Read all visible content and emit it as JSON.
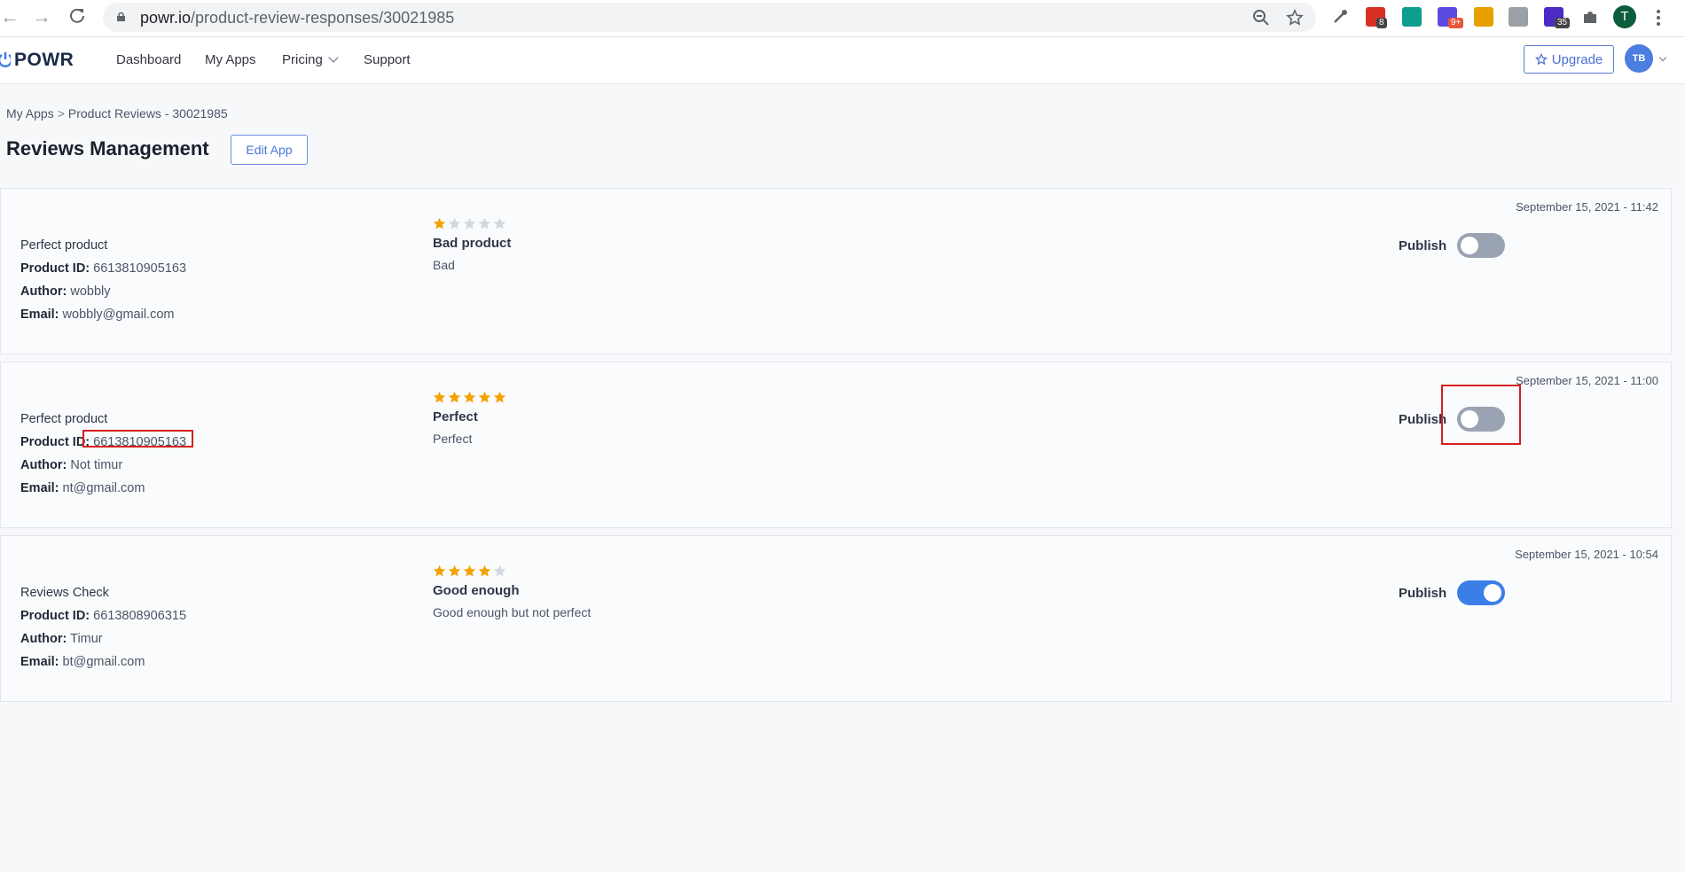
{
  "browser": {
    "url_host": "powr.io",
    "url_path": "/product-review-responses/30021985",
    "extensions": [
      {
        "icon": "mail-extension-icon",
        "badge": "8",
        "color": "#d93025"
      },
      {
        "icon": "chat-extension-icon",
        "badge": "",
        "color": "#0f9d8f"
      },
      {
        "icon": "sun-extension-icon",
        "badge": "9+",
        "color": "#5b4be0"
      },
      {
        "icon": "number-extension-icon",
        "badge": "",
        "color": "#e8a000"
      },
      {
        "icon": "profile-extension-icon",
        "badge": "",
        "color": "#9aa0a6"
      },
      {
        "icon": "graduation-extension-icon",
        "badge": "35",
        "color": "#4b2ac6"
      }
    ],
    "profile_initial": "T"
  },
  "header": {
    "logo": "POWR",
    "nav": [
      "Dashboard",
      "My Apps",
      "Pricing",
      "Support"
    ],
    "upgrade_label": "Upgrade",
    "user_initials": "TB"
  },
  "breadcrumb": {
    "root": "My Apps",
    "separator": ">",
    "current": "Product Reviews - 30021985"
  },
  "page": {
    "title": "Reviews Management",
    "edit_label": "Edit App"
  },
  "labels": {
    "product_id": "Product ID:",
    "author": "Author:",
    "email": "Email:",
    "publish": "Publish"
  },
  "reviews": [
    {
      "date": "September 15, 2021 - 11:42",
      "product_name": "Perfect product",
      "product_id": "6613810905163",
      "author": "wobbly",
      "email": "wobbly@gmail.com",
      "rating": 1,
      "title": "Bad product",
      "body": "Bad",
      "published": false
    },
    {
      "date": "September 15, 2021 - 11:00",
      "product_name": "Perfect product",
      "product_id": "6613810905163",
      "author": "Not timur",
      "email": "nt@gmail.com",
      "rating": 5,
      "title": "Perfect",
      "body": "Perfect",
      "published": false
    },
    {
      "date": "September 15, 2021 - 10:54",
      "product_name": "Reviews Check",
      "product_id": "6613808906315",
      "author": "Timur",
      "email": "bt@gmail.com",
      "rating": 4,
      "title": "Good enough",
      "body": "Good enough but not perfect",
      "published": true
    }
  ],
  "colors": {
    "star_filled": "#f5a100",
    "star_empty": "#d3d8e0",
    "toggle_on": "#3b7ee8",
    "toggle_off": "#9aa3b2",
    "highlight": "#d61f1f"
  }
}
